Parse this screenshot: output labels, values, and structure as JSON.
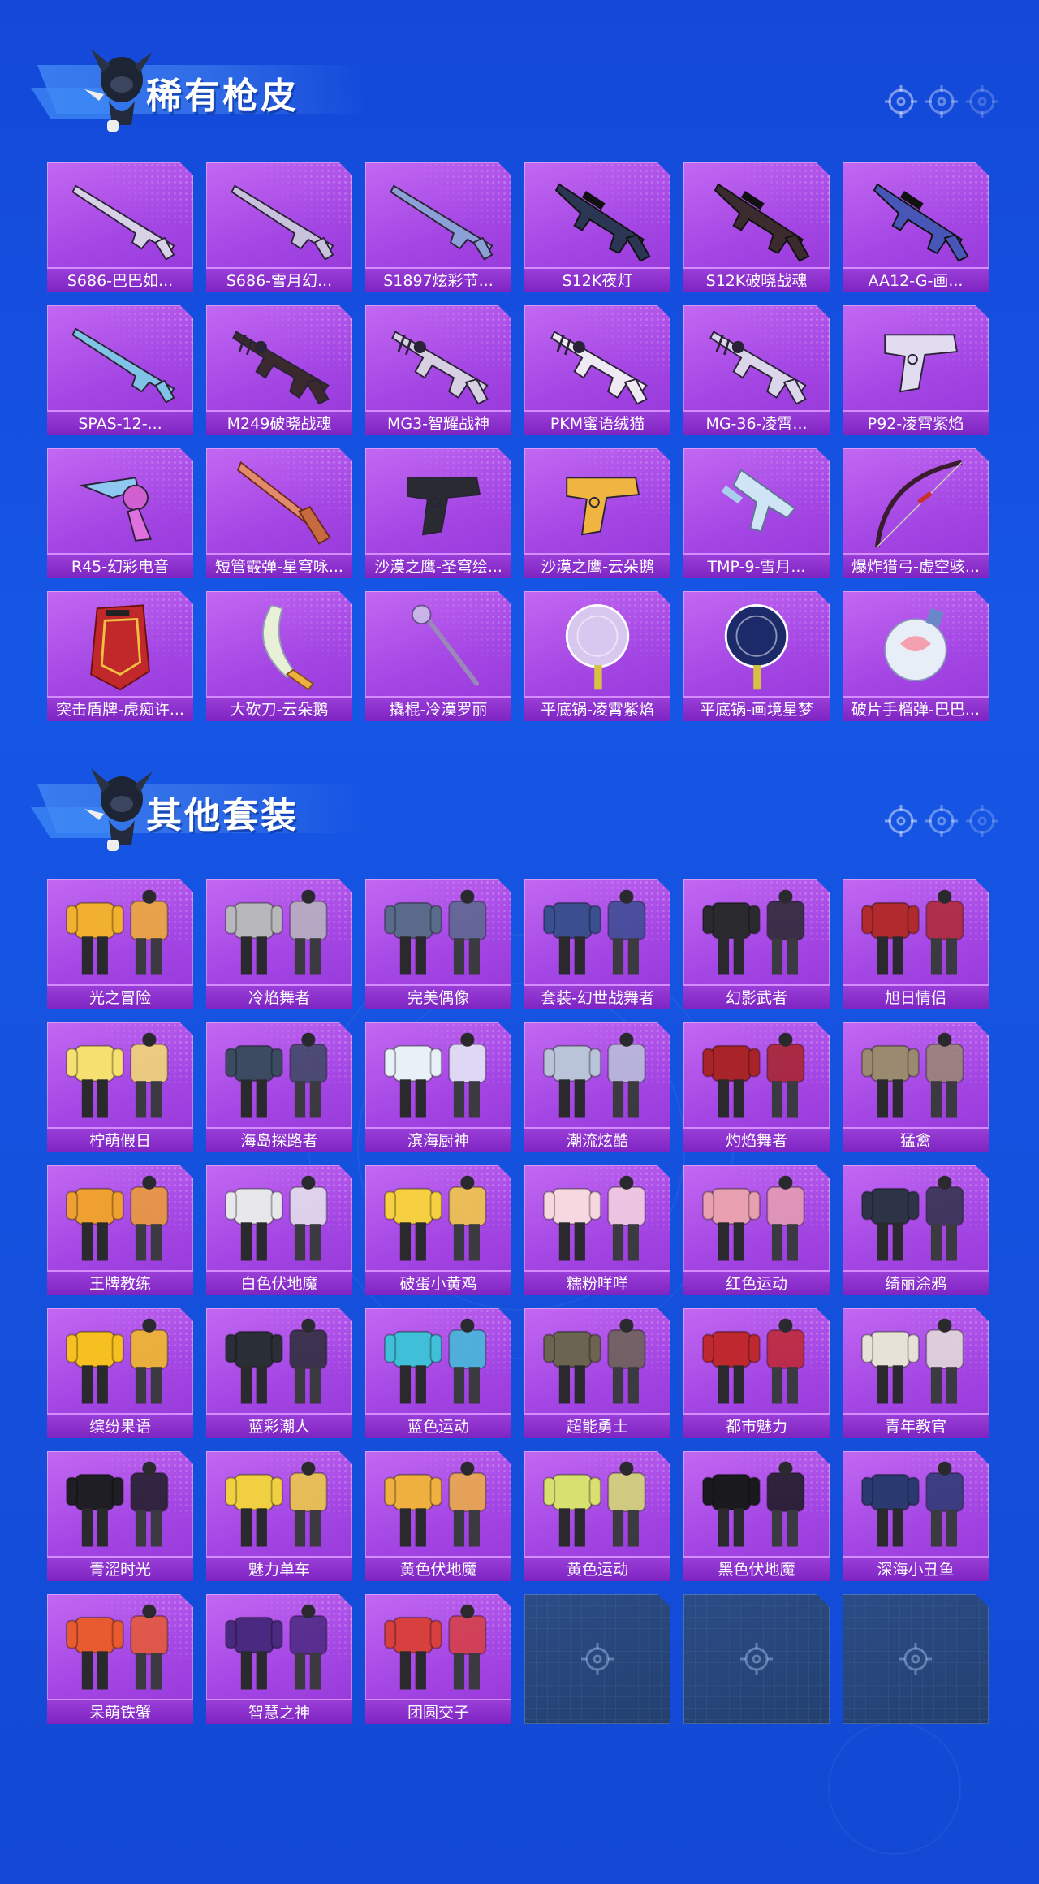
{
  "sections": [
    {
      "title": "稀有枪皮",
      "items": [
        {
          "label": "S686-巴巴如...",
          "icon": "shotgun-icon",
          "color": "#d8d2e6"
        },
        {
          "label": "S686-雪月幻...",
          "icon": "shotgun-icon",
          "color": "#c9c2dc"
        },
        {
          "label": "S1897炫彩节...",
          "icon": "shotgun-icon",
          "color": "#8aa0d6"
        },
        {
          "label": "S12K夜灯",
          "icon": "rifle-icon",
          "color": "#2b3654"
        },
        {
          "label": "S12K破晓战魂",
          "icon": "rifle-icon",
          "color": "#3b2a2e"
        },
        {
          "label": "AA12-G-画...",
          "icon": "rifle-icon",
          "color": "#4856b8"
        },
        {
          "label": "SPAS-12-...",
          "icon": "shotgun-icon",
          "color": "#7fc4e6"
        },
        {
          "label": "M249破晓战魂",
          "icon": "machine-gun-icon",
          "color": "#3a2a2e"
        },
        {
          "label": "MG3-智耀战神",
          "icon": "machine-gun-icon",
          "color": "#d6d0e2"
        },
        {
          "label": "PKM蜜语绒猫",
          "icon": "machine-gun-icon",
          "color": "#efe9f3"
        },
        {
          "label": "MG-36-凌霄...",
          "icon": "machine-gun-icon",
          "color": "#dcd6ea"
        },
        {
          "label": "P92-凌霄紫焰",
          "icon": "pistol-icon",
          "color": "#e2dcf0"
        },
        {
          "label": "R45-幻彩电音",
          "icon": "revolver-icon",
          "color": "#8fc8f0"
        },
        {
          "label": "短管霰弹-星穹咏...",
          "icon": "sawed-off-icon",
          "color": "#e38a6a"
        },
        {
          "label": "沙漠之鹰-圣穹绘...",
          "icon": "pistol-icon",
          "color": "#2a2a32"
        },
        {
          "label": "沙漠之鹰-云朵鹅",
          "icon": "pistol-icon",
          "color": "#f0b440"
        },
        {
          "label": "TMP-9-雪月...",
          "icon": "smg-icon",
          "color": "#cfe4f4"
        },
        {
          "label": "爆炸猎弓-虚空骇...",
          "icon": "bow-icon",
          "color": "#3a1c2e"
        },
        {
          "label": "突击盾牌-虎痴许...",
          "icon": "shield-icon",
          "color": "#c0282a"
        },
        {
          "label": "大砍刀-云朵鹅",
          "icon": "machete-icon",
          "color": "#e8f0d8"
        },
        {
          "label": "撬棍-冷漠罗丽",
          "icon": "crowbar-icon",
          "color": "#c8b4e8"
        },
        {
          "label": "平底锅-凌霄紫焰",
          "icon": "frying-pan-icon",
          "color": "#d8c8f0"
        },
        {
          "label": "平底锅-画境星梦",
          "icon": "frying-pan-icon",
          "color": "#1c2a6a"
        },
        {
          "label": "破片手榴弹-巴巴...",
          "icon": "grenade-icon",
          "color": "#e8eef8"
        }
      ]
    },
    {
      "title": "其他套装",
      "items": [
        {
          "label": "光之冒险",
          "icon": "outfit-icon",
          "color": "#f2b030"
        },
        {
          "label": "冷焰舞者",
          "icon": "outfit-icon",
          "color": "#b8b8bc"
        },
        {
          "label": "完美偶像",
          "icon": "outfit-icon",
          "color": "#5a6a8a"
        },
        {
          "label": "套装-幻世战舞者",
          "icon": "outfit-icon",
          "color": "#3a4e90"
        },
        {
          "label": "幻影武者",
          "icon": "outfit-icon",
          "color": "#2a2a2e"
        },
        {
          "label": "旭日情侣",
          "icon": "outfit-icon",
          "color": "#b02a2e"
        },
        {
          "label": "柠萌假日",
          "icon": "outfit-icon",
          "color": "#f6e070"
        },
        {
          "label": "海岛探路者",
          "icon": "outfit-icon",
          "color": "#3c4a62"
        },
        {
          "label": "滨海厨神",
          "icon": "outfit-icon",
          "color": "#e8f0f8"
        },
        {
          "label": "潮流炫酷",
          "icon": "outfit-icon",
          "color": "#bac4d8"
        },
        {
          "label": "灼焰舞者",
          "icon": "outfit-icon",
          "color": "#a82428"
        },
        {
          "label": "猛禽",
          "icon": "outfit-icon",
          "color": "#9a8a70"
        },
        {
          "label": "王牌教练",
          "icon": "outfit-icon",
          "color": "#f0a030"
        },
        {
          "label": "白色伏地魔",
          "icon": "outfit-icon",
          "color": "#e8e8ec"
        },
        {
          "label": "破蛋小黄鸡",
          "icon": "outfit-icon",
          "color": "#f6d040"
        },
        {
          "label": "糯粉咩咩",
          "icon": "outfit-icon",
          "color": "#f8d8e0"
        },
        {
          "label": "红色运动",
          "icon": "outfit-icon",
          "color": "#e8a0b0"
        },
        {
          "label": "绮丽涂鸦",
          "icon": "outfit-icon",
          "color": "#2e3448"
        },
        {
          "label": "缤纷果语",
          "icon": "outfit-icon",
          "color": "#f6c020"
        },
        {
          "label": "蓝彩潮人",
          "icon": "outfit-icon",
          "color": "#2a2e36"
        },
        {
          "label": "蓝色运动",
          "icon": "outfit-icon",
          "color": "#40c0d8"
        },
        {
          "label": "超能勇士",
          "icon": "outfit-icon",
          "color": "#6a6450"
        },
        {
          "label": "都市魅力",
          "icon": "outfit-icon",
          "color": "#c02830"
        },
        {
          "label": "青年教官",
          "icon": "outfit-icon",
          "color": "#e6e2d8"
        },
        {
          "label": "青涩时光",
          "icon": "outfit-icon",
          "color": "#1e1e24"
        },
        {
          "label": "魅力单车",
          "icon": "outfit-icon",
          "color": "#f0d040"
        },
        {
          "label": "黄色伏地魔",
          "icon": "outfit-icon",
          "color": "#f0b040"
        },
        {
          "label": "黄色运动",
          "icon": "outfit-icon",
          "color": "#d8e070"
        },
        {
          "label": "黑色伏地魔",
          "icon": "outfit-icon",
          "color": "#1a1a1e"
        },
        {
          "label": "深海小丑鱼",
          "icon": "outfit-icon",
          "color": "#2a3a70"
        },
        {
          "label": "呆萌铁蟹",
          "icon": "outfit-icon",
          "color": "#e85a30"
        },
        {
          "label": "智慧之神",
          "icon": "outfit-icon",
          "color": "#4a2a80"
        },
        {
          "label": "团圆交子",
          "icon": "outfit-icon",
          "color": "#d84040"
        }
      ],
      "empty_slots": 3
    }
  ],
  "colors": {
    "card_purple": "#a446e4",
    "label_purple": "#7e24c2",
    "empty_slot": "#263f6e",
    "background": "#1452e0"
  }
}
